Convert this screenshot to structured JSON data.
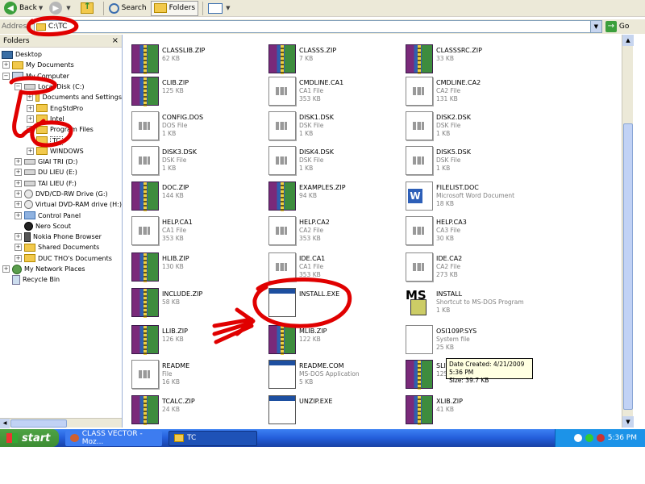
{
  "toolbar": {
    "back_label": "Back",
    "search_label": "Search",
    "folders_label": "Folders"
  },
  "address": {
    "label": "Address",
    "value": "C:\\TC",
    "go_label": "Go"
  },
  "folders_pane": {
    "title": "Folders",
    "close": "×",
    "items": [
      {
        "label": "Desktop"
      },
      {
        "label": "My Documents"
      },
      {
        "label": "My Computer"
      },
      {
        "label": "Local Disk (C:)"
      },
      {
        "label": "Documents and Settings"
      },
      {
        "label": "EngStdPro"
      },
      {
        "label": "Intel"
      },
      {
        "label": "Program Files"
      },
      {
        "label": "TC"
      },
      {
        "label": "WINDOWS"
      },
      {
        "label": "GIAI TRI (D:)"
      },
      {
        "label": "DU LIEU (E:)"
      },
      {
        "label": "TAI LIEU (F:)"
      },
      {
        "label": "DVD/CD-RW Drive (G:)"
      },
      {
        "label": "Virtual DVD-RAM drive (H:)"
      },
      {
        "label": "Control Panel"
      },
      {
        "label": "Nero Scout"
      },
      {
        "label": "Nokia Phone Browser"
      },
      {
        "label": "Shared Documents"
      },
      {
        "label": "DUC THO's Documents"
      },
      {
        "label": "My Network Places"
      },
      {
        "label": "Recycle Bin"
      }
    ]
  },
  "files": [
    {
      "name": "CLASSLIB.ZIP",
      "type": "",
      "size": "62 KB"
    },
    {
      "name": "CLASSS.ZIP",
      "type": "",
      "size": "7 KB"
    },
    {
      "name": "CLASSSRC.ZIP",
      "type": "",
      "size": "33 KB"
    },
    {
      "name": "CLIB.ZIP",
      "type": "",
      "size": "125 KB"
    },
    {
      "name": "CMDLINE.CA1",
      "type": "CA1 File",
      "size": "353 KB"
    },
    {
      "name": "CMDLINE.CA2",
      "type": "CA2 File",
      "size": "131 KB"
    },
    {
      "name": "CONFIG.DOS",
      "type": "DOS File",
      "size": "1 KB"
    },
    {
      "name": "DISK1.DSK",
      "type": "DSK File",
      "size": "1 KB"
    },
    {
      "name": "DISK2.DSK",
      "type": "DSK File",
      "size": "1 KB"
    },
    {
      "name": "DISK3.DSK",
      "type": "DSK File",
      "size": "1 KB"
    },
    {
      "name": "DISK4.DSK",
      "type": "DSK File",
      "size": "1 KB"
    },
    {
      "name": "DISK5.DSK",
      "type": "DSK File",
      "size": "1 KB"
    },
    {
      "name": "DOC.ZIP",
      "type": "",
      "size": "144 KB"
    },
    {
      "name": "EXAMPLES.ZIP",
      "type": "",
      "size": "94 KB"
    },
    {
      "name": "FILELIST.DOC",
      "type": "Microsoft Word Document",
      "size": "18 KB"
    },
    {
      "name": "HELP.CA1",
      "type": "CA1 File",
      "size": "353 KB"
    },
    {
      "name": "HELP.CA2",
      "type": "CA2 File",
      "size": "353 KB"
    },
    {
      "name": "HELP.CA3",
      "type": "CA3 File",
      "size": "30 KB"
    },
    {
      "name": "HLIB.ZIP",
      "type": "",
      "size": "130 KB"
    },
    {
      "name": "IDE.CA1",
      "type": "CA1 File",
      "size": "353 KB"
    },
    {
      "name": "IDE.CA2",
      "type": "CA2 File",
      "size": "273 KB"
    },
    {
      "name": "INCLUDE.ZIP",
      "type": "",
      "size": "58 KB"
    },
    {
      "name": "INSTALL.EXE",
      "type": "",
      "size": ""
    },
    {
      "name": "INSTALL",
      "type": "Shortcut to MS-DOS Program",
      "size": "1 KB"
    },
    {
      "name": "LLIB.ZIP",
      "type": "",
      "size": "126 KB"
    },
    {
      "name": "MLIB.ZIP",
      "type": "",
      "size": "122 KB"
    },
    {
      "name": "OSI109P.SYS",
      "type": "System file",
      "size": "25 KB"
    },
    {
      "name": "README",
      "type": "File",
      "size": "16 KB"
    },
    {
      "name": "README.COM",
      "type": "MS-DOS Application",
      "size": "5 KB"
    },
    {
      "name": "SLIB.ZIP",
      "type": "",
      "size": "125 KB"
    },
    {
      "name": "TCALC.ZIP",
      "type": "",
      "size": "24 KB"
    },
    {
      "name": "UNZIP.EXE",
      "type": "",
      "size": ""
    },
    {
      "name": "XLIB.ZIP",
      "type": "",
      "size": "41 KB"
    }
  ],
  "tooltip": {
    "line1": "Date Created: 4/21/2009 5:36 PM",
    "line2": "Size: 39.7 KB"
  },
  "taskbar": {
    "start_label": "start",
    "tasks": [
      {
        "label": "CLASS VECTOR - Moz..."
      },
      {
        "label": "TC"
      }
    ],
    "clock": "5:36 PM"
  },
  "annotation_color": "#e00000"
}
